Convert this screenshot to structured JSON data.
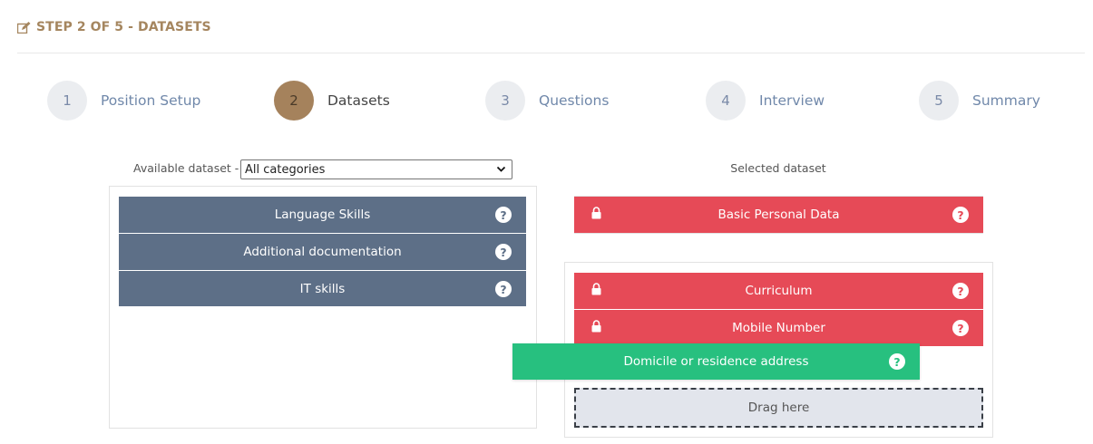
{
  "header": {
    "title": "STEP 2 OF 5 - DATASETS",
    "icon": "edit-icon",
    "color": "#a5865f"
  },
  "stepper": {
    "active_index": 2,
    "steps": [
      {
        "number": "1",
        "label": "Position Setup"
      },
      {
        "number": "2",
        "label": "Datasets"
      },
      {
        "number": "3",
        "label": "Questions"
      },
      {
        "number": "4",
        "label": "Interview"
      },
      {
        "number": "5",
        "label": "Summary"
      }
    ]
  },
  "available": {
    "label": "Available dataset -",
    "select_value": "All categories",
    "items": [
      {
        "label": "Language Skills",
        "help": "?"
      },
      {
        "label": "Additional documentation",
        "help": "?"
      },
      {
        "label": "IT skills",
        "help": "?"
      }
    ]
  },
  "selected": {
    "label": "Selected dataset",
    "locked_items": [
      {
        "label": "Basic Personal Data",
        "help": "?"
      },
      {
        "label": "Curriculum",
        "help": "?"
      },
      {
        "label": "Mobile Number",
        "help": "?"
      }
    ],
    "dragging_item": {
      "label": "Domicile or residence address",
      "help": "?"
    },
    "drop_zone": "Drag here"
  },
  "colors": {
    "available_item": "#5d6f87",
    "locked_item": "#e64a57",
    "dragging_item": "#27c07f",
    "active_step": "#a5825c"
  }
}
